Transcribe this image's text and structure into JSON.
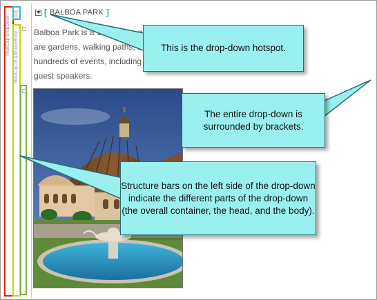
{
  "structure_bars": {
    "container_label": "MadCap:dropDown",
    "head_label": "MadCap:dropDownHead",
    "body_label": "MadCap:dropDownBody",
    "small_label": "[dd]",
    "colors": {
      "container": "#d9231c",
      "head": "#c9d400",
      "body": "#79b43a",
      "hotspot": "#38b9d9"
    }
  },
  "dropdown": {
    "open_bracket": "[",
    "title": "BALBOA PARK",
    "close_bracket": "]",
    "paragraph_lines": [
      "Balboa Park is a 1,200 acre park in San Diego. Inside the park",
      "are gardens, walking paths, museums, and more. The park hosts",
      "hundreds of events, including concerts, festivals, parades, and",
      "guest speakers."
    ]
  },
  "callouts": [
    "This is the drop-down hotspot.",
    "The entire drop-down is surrounded by brackets.",
    "Structure bars on the left side of the drop-down indicate the different parts of the drop-down (the overall container, the head, and the body)."
  ],
  "colors": {
    "callout_fill": "#9af0ee",
    "callout_border": "#2b6b71",
    "bracket": "#2fa8c9"
  }
}
